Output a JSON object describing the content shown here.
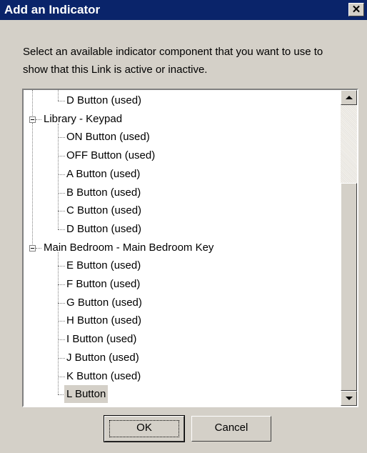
{
  "window": {
    "title": "Add an Indicator",
    "close_glyph": "✕"
  },
  "instructions": "Select an available indicator component that you want to use to show that this Link is active or inactive.",
  "tree": {
    "rows": [
      {
        "label": "D Button (used)",
        "level": 1
      },
      {
        "label": "Library - Keypad",
        "level": 0,
        "expander": "minus"
      },
      {
        "label": "ON Button (used)",
        "level": 1
      },
      {
        "label": "OFF Button (used)",
        "level": 1
      },
      {
        "label": "A Button (used)",
        "level": 1
      },
      {
        "label": "B Button (used)",
        "level": 1
      },
      {
        "label": "C Button (used)",
        "level": 1
      },
      {
        "label": "D Button (used)",
        "level": 1
      },
      {
        "label": "Main Bedroom - Main Bedroom Key",
        "level": 0,
        "expander": "minus"
      },
      {
        "label": "E Button (used)",
        "level": 1
      },
      {
        "label": "F Button (used)",
        "level": 1
      },
      {
        "label": "G Button (used)",
        "level": 1
      },
      {
        "label": "H Button (used)",
        "level": 1
      },
      {
        "label": "I Button (used)",
        "level": 1
      },
      {
        "label": "J Button (used)",
        "level": 1
      },
      {
        "label": "K Button (used)",
        "level": 1
      },
      {
        "label": "L Button",
        "level": 1,
        "selected": true
      }
    ]
  },
  "buttons": {
    "ok": "OK",
    "cancel": "Cancel"
  },
  "colors": {
    "titlebar": "#0a246a",
    "face": "#d4d0c8",
    "selection": "#d4d0c8"
  }
}
